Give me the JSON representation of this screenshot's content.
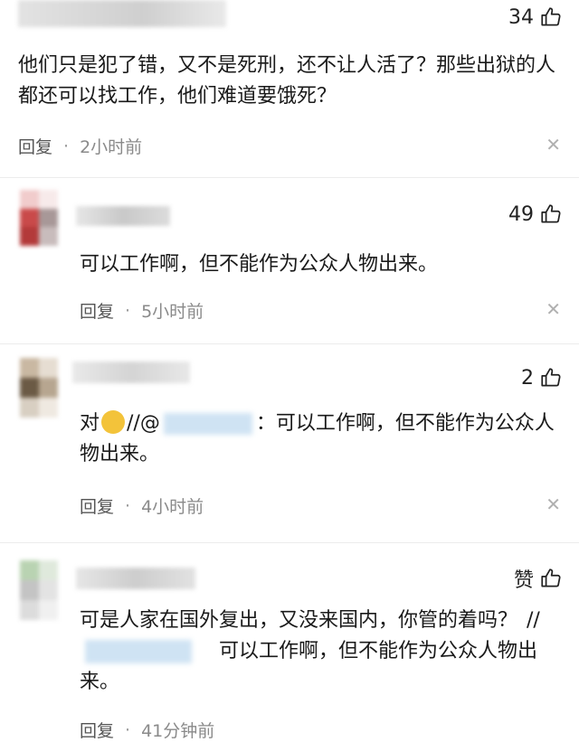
{
  "comments": [
    {
      "likes": "34",
      "text": "他们只是犯了错，又不是死刑，还不让人活了？那些出狱的人都还可以找工作，他们难道要饿死？",
      "reply_label": "回复",
      "dot": "·",
      "time": "2小时前"
    },
    {
      "likes": "49",
      "text": "可以工作啊，但不能作为公众人物出来。",
      "reply_label": "回复",
      "dot": "·",
      "time": "5小时前"
    },
    {
      "likes": "2",
      "prefix": "对",
      "reply_marker": "//@",
      "quoted": "：可以工作啊，但不能作为公众人物出来。",
      "reply_label": "回复",
      "dot": "·",
      "time": "4小时前"
    },
    {
      "likes_label": "赞",
      "text": "可是人家在国外复出，又没来国内，你管的着吗？",
      "reply_marker": "//",
      "quoted": "可以工作啊，但不能作为公众人物出来。",
      "reply_label": "回复",
      "dot": "·",
      "time": "41分钟前"
    }
  ],
  "icons": {
    "like": "thumbs-up-icon",
    "close": "close-icon",
    "emoji": "face-emoji-icon"
  },
  "colors": {
    "mask": "#cfe3f3",
    "text": "#1a1a1a",
    "meta": "#8a8a8a"
  }
}
